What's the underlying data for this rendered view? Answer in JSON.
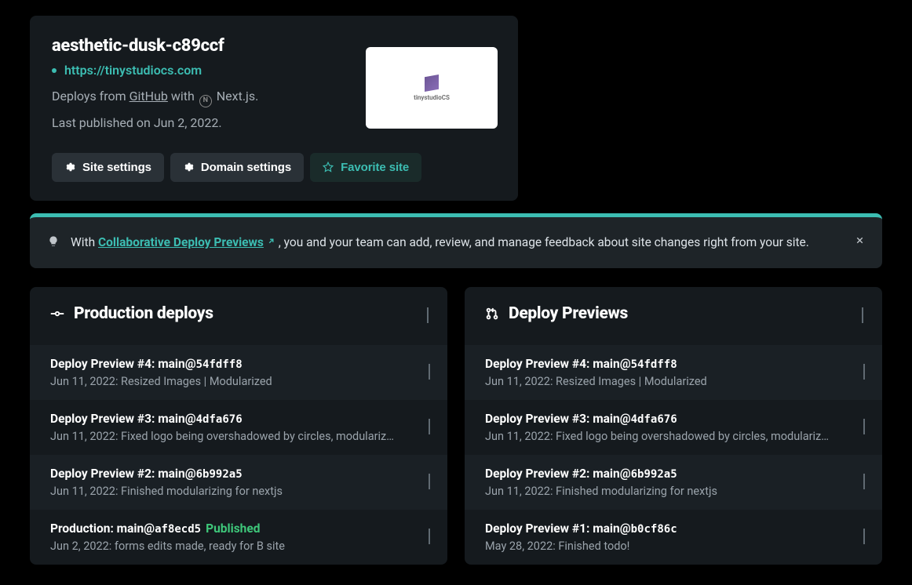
{
  "site": {
    "name": "aesthetic-dusk-c89ccf",
    "url": "https://tinystudiocs.com",
    "deploys_from_prefix": "Deploys from ",
    "git_provider": "GitHub",
    "with_text": " with ",
    "framework": "Next.js",
    "last_published": "Last published on Jun 2, 2022.",
    "thumb_label": "tinystudioCS"
  },
  "buttons": {
    "site_settings": "Site settings",
    "domain_settings": "Domain settings",
    "favorite": "Favorite site"
  },
  "banner": {
    "prefix": "With ",
    "link": "Collaborative Deploy Previews",
    "suffix": " , you and your team can add, review, and manage feedback about site changes right from your site."
  },
  "columns": {
    "production": {
      "title": "Production deploys",
      "rows": [
        {
          "title_a": "Deploy Preview #4: ",
          "title_b": "main@",
          "hash": "54fdff8",
          "badge": "",
          "sub": "Jun 11, 2022: Resized Images | Modularized"
        },
        {
          "title_a": "Deploy Preview #3: ",
          "title_b": "main@",
          "hash": "4dfa676",
          "badge": "",
          "sub": "Jun 11, 2022: Fixed logo being overshadowed by circles, modulariz…"
        },
        {
          "title_a": "Deploy Preview #2: ",
          "title_b": "main@",
          "hash": "6b992a5",
          "badge": "",
          "sub": "Jun 11, 2022: Finished modularizing for nextjs"
        },
        {
          "title_a": "Production: ",
          "title_b": "main@",
          "hash": "af8ecd5",
          "badge": "Published",
          "sub": "Jun 2, 2022: forms edits made, ready for B site"
        }
      ]
    },
    "previews": {
      "title": "Deploy Previews",
      "rows": [
        {
          "title_a": "Deploy Preview #4: ",
          "title_b": "main@",
          "hash": "54fdff8",
          "sub": "Jun 11, 2022: Resized Images | Modularized"
        },
        {
          "title_a": "Deploy Preview #3: ",
          "title_b": "main@",
          "hash": "4dfa676",
          "sub": "Jun 11, 2022: Fixed logo being overshadowed by circles, modulariz…"
        },
        {
          "title_a": "Deploy Preview #2: ",
          "title_b": "main@",
          "hash": "6b992a5",
          "sub": "Jun 11, 2022: Finished modularizing for nextjs"
        },
        {
          "title_a": "Deploy Preview #1: ",
          "title_b": "main@",
          "hash": "b0cf86c",
          "sub": "May 28, 2022: Finished todo!"
        }
      ]
    }
  }
}
